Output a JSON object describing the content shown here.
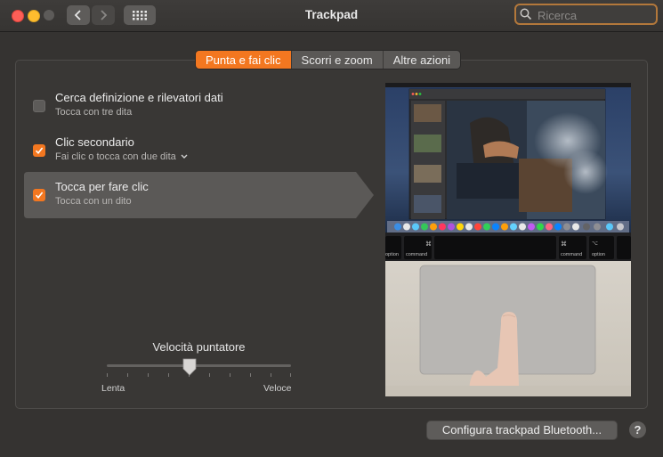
{
  "window": {
    "title": "Trackpad",
    "search_placeholder": "Ricerca"
  },
  "tabs": [
    {
      "label": "Punta e fai clic",
      "active": true
    },
    {
      "label": "Scorri e zoom",
      "active": false
    },
    {
      "label": "Altre azioni",
      "active": false
    }
  ],
  "options": [
    {
      "title": "Cerca definizione e rilevatori dati",
      "subtitle": "Tocca con tre dita",
      "checked": false
    },
    {
      "title": "Clic secondario",
      "subtitle": "Fai clic o tocca con due dita",
      "checked": true
    },
    {
      "title": "Tocca per fare clic",
      "subtitle": "Tocca con un dito",
      "checked": true,
      "selected": true
    }
  ],
  "speed": {
    "label": "Velocità puntatore",
    "min_label": "Lenta",
    "max_label": "Veloce",
    "value_fraction": 0.45
  },
  "preview": {
    "key_left_symbol": "⌘",
    "key_left_label": "command",
    "key_right_symbol": "⌘",
    "key_right_label": "command",
    "key_option_left": "option",
    "key_option_right": "option",
    "key_alt_symbol": "⌥"
  },
  "footer": {
    "bluetooth_button": "Configura trackpad Bluetooth...",
    "help_label": "?"
  },
  "colors": {
    "accent": "#f37720",
    "background": "#353331"
  }
}
